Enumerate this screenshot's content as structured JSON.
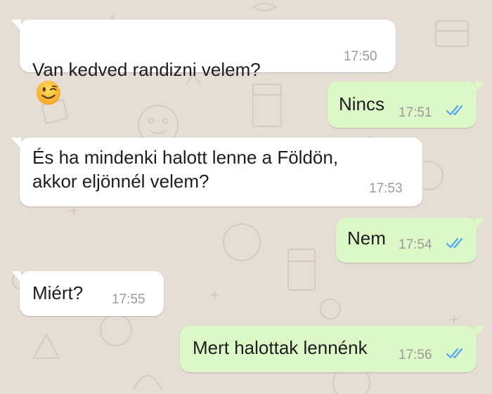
{
  "theme": {
    "wallpaper": "#e6ddd4",
    "incoming_bubble": "#ffffff",
    "outgoing_bubble": "#dcf8c6",
    "read_ticks": "#4fa8f0",
    "time_color": "#9a9a9a"
  },
  "messages": [
    {
      "direction": "incoming",
      "text": "Van kedved randizni velem?",
      "emoji": "winking-face-emoji",
      "time": "17:50"
    },
    {
      "direction": "outgoing",
      "text": "Nincs",
      "time": "17:51",
      "status": "read"
    },
    {
      "direction": "incoming",
      "text": "És ha mindenki halott lenne a Földön,\nakkor eljönnél velem?",
      "time": "17:53"
    },
    {
      "direction": "outgoing",
      "text": "Nem",
      "time": "17:54",
      "status": "read"
    },
    {
      "direction": "incoming",
      "text": "Miért?",
      "time": "17:55"
    },
    {
      "direction": "outgoing",
      "text": "Mert halottak lennénk",
      "time": "17:56",
      "status": "read"
    }
  ]
}
